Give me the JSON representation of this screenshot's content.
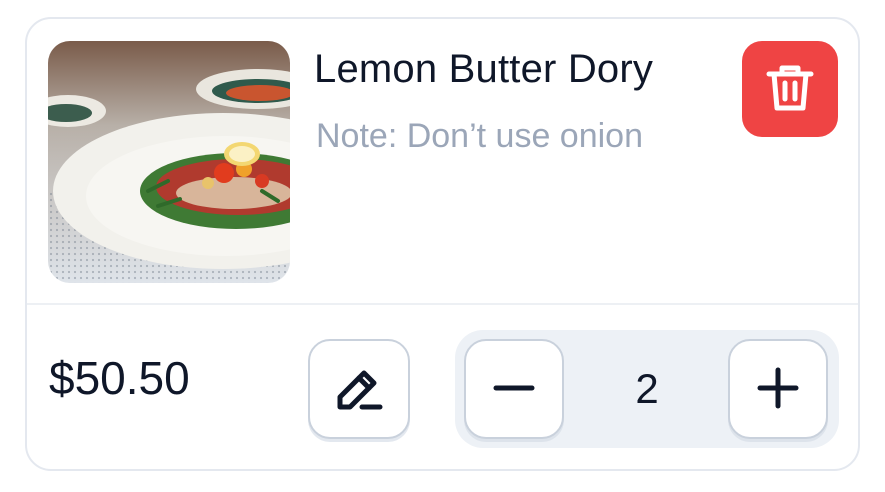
{
  "item": {
    "name": "Lemon Butter Dory",
    "note": "Note: Don’t use onion",
    "price": "$50.50",
    "quantity": "2",
    "image_alt": "Plated dish with greens, tomatoes and lemon slice"
  },
  "icons": {
    "delete": "trash-icon",
    "edit": "pencil-icon",
    "decrease": "minus-icon",
    "increase": "plus-icon"
  },
  "colors": {
    "danger": "#ef4444",
    "text_primary": "#0f1729",
    "text_muted": "#9ba6b8",
    "border": "#e4e8ef",
    "stepper_bg": "#edf1f6"
  }
}
